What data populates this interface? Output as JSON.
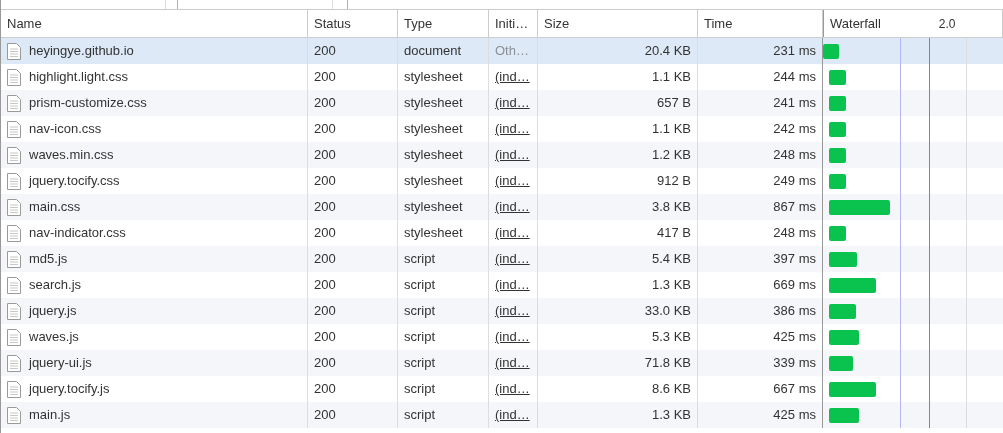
{
  "table": {
    "columns": [
      "Name",
      "Status",
      "Type",
      "Initi…",
      "Size",
      "Time",
      "Waterfall"
    ],
    "waterfall_tick": "2.0",
    "rows": [
      {
        "name": "heyingye.github.io",
        "status": "200",
        "type": "document",
        "initiator": "Oth…",
        "kind": "other",
        "size": "20.4 KB",
        "time": "231 ms",
        "selected": true
      },
      {
        "name": "highlight.light.css",
        "status": "200",
        "type": "stylesheet",
        "initiator": "(ind…",
        "kind": "link",
        "size": "1.1 KB",
        "time": "244 ms",
        "selected": false
      },
      {
        "name": "prism-customize.css",
        "status": "200",
        "type": "stylesheet",
        "initiator": "(ind…",
        "kind": "link",
        "size": "657 B",
        "time": "241 ms",
        "selected": false
      },
      {
        "name": "nav-icon.css",
        "status": "200",
        "type": "stylesheet",
        "initiator": "(ind…",
        "kind": "link",
        "size": "1.1 KB",
        "time": "242 ms",
        "selected": false
      },
      {
        "name": "waves.min.css",
        "status": "200",
        "type": "stylesheet",
        "initiator": "(ind…",
        "kind": "link",
        "size": "1.2 KB",
        "time": "248 ms",
        "selected": false
      },
      {
        "name": "jquery.tocify.css",
        "status": "200",
        "type": "stylesheet",
        "initiator": "(ind…",
        "kind": "link",
        "size": "912 B",
        "time": "249 ms",
        "selected": false
      },
      {
        "name": "main.css",
        "status": "200",
        "type": "stylesheet",
        "initiator": "(ind…",
        "kind": "link",
        "size": "3.8 KB",
        "time": "867 ms",
        "selected": false
      },
      {
        "name": "nav-indicator.css",
        "status": "200",
        "type": "stylesheet",
        "initiator": "(ind…",
        "kind": "link",
        "size": "417 B",
        "time": "248 ms",
        "selected": false
      },
      {
        "name": "md5.js",
        "status": "200",
        "type": "script",
        "initiator": "(ind…",
        "kind": "link",
        "size": "5.4 KB",
        "time": "397 ms",
        "selected": false
      },
      {
        "name": "search.js",
        "status": "200",
        "type": "script",
        "initiator": "(ind…",
        "kind": "link",
        "size": "1.3 KB",
        "time": "669 ms",
        "selected": false
      },
      {
        "name": "jquery.js",
        "status": "200",
        "type": "script",
        "initiator": "(ind…",
        "kind": "link",
        "size": "33.0 KB",
        "time": "386 ms",
        "selected": false
      },
      {
        "name": "waves.js",
        "status": "200",
        "type": "script",
        "initiator": "(ind…",
        "kind": "link",
        "size": "5.3 KB",
        "time": "425 ms",
        "selected": false
      },
      {
        "name": "jquery-ui.js",
        "status": "200",
        "type": "script",
        "initiator": "(ind…",
        "kind": "link",
        "size": "71.8 KB",
        "time": "339 ms",
        "selected": false
      },
      {
        "name": "jquery.tocify.js",
        "status": "200",
        "type": "script",
        "initiator": "(ind…",
        "kind": "link",
        "size": "8.6 KB",
        "time": "667 ms",
        "selected": false
      },
      {
        "name": "main.js",
        "status": "200",
        "type": "script",
        "initiator": "(ind…",
        "kind": "link",
        "size": "1.3 KB",
        "time": "425 ms",
        "selected": false
      }
    ]
  }
}
